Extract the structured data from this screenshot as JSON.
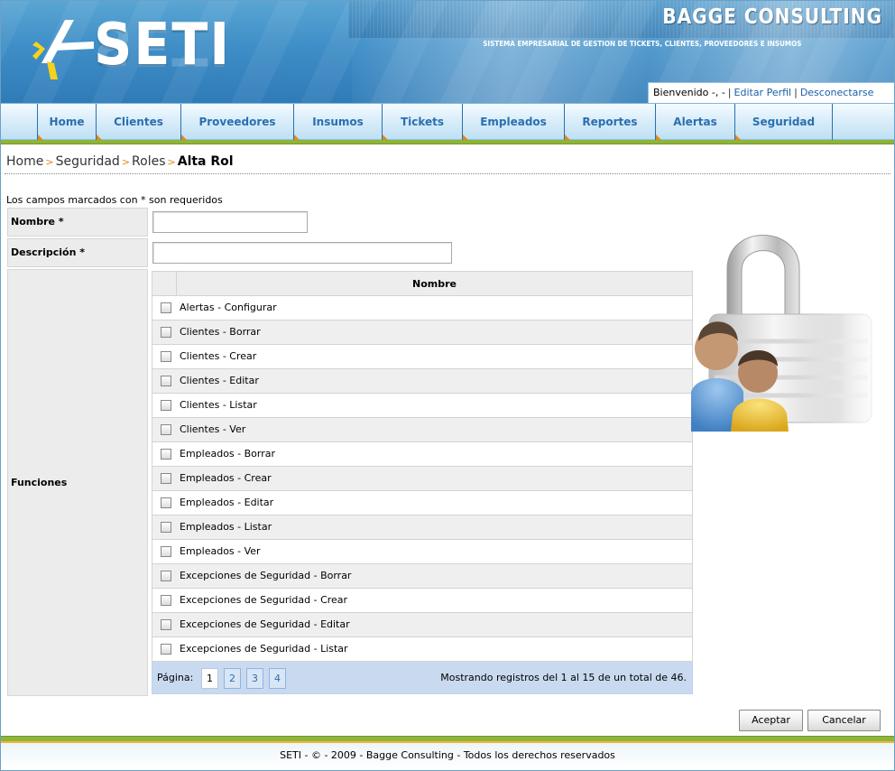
{
  "header": {
    "logo_text": "SETI",
    "brand": "BAGGE CONSULTING",
    "tagline": "SISTEMA EMPRESARIAL DE GESTION DE TICKETS, CLIENTES, PROVEEDORES E INSUMOS",
    "welcome": "Bienvenido -, -",
    "edit_profile": "Editar Perfil",
    "logout": "Desconectarse"
  },
  "nav": {
    "items": [
      {
        "label": "Home"
      },
      {
        "label": "Clientes"
      },
      {
        "label": "Proveedores"
      },
      {
        "label": "Insumos"
      },
      {
        "label": "Tickets"
      },
      {
        "label": "Empleados"
      },
      {
        "label": "Reportes"
      },
      {
        "label": "Alertas"
      },
      {
        "label": "Seguridad"
      }
    ]
  },
  "breadcrumb": {
    "items": [
      "Home",
      "Seguridad",
      "Roles"
    ],
    "current": "Alta Rol"
  },
  "form": {
    "required_note": "Los campos marcados con * son requeridos",
    "nombre_label": "Nombre *",
    "nombre_value": "",
    "descripcion_label": "Descripción *",
    "descripcion_value": "",
    "funciones_label": "Funciones"
  },
  "grid": {
    "column_header": "Nombre",
    "rows": [
      {
        "label": "Alertas - Configurar",
        "checked": false
      },
      {
        "label": "Clientes - Borrar",
        "checked": false
      },
      {
        "label": "Clientes - Crear",
        "checked": false
      },
      {
        "label": "Clientes - Editar",
        "checked": false
      },
      {
        "label": "Clientes - Listar",
        "checked": false
      },
      {
        "label": "Clientes - Ver",
        "checked": false
      },
      {
        "label": "Empleados - Borrar",
        "checked": false
      },
      {
        "label": "Empleados - Crear",
        "checked": false
      },
      {
        "label": "Empleados - Editar",
        "checked": false
      },
      {
        "label": "Empleados - Listar",
        "checked": false
      },
      {
        "label": "Empleados - Ver",
        "checked": false
      },
      {
        "label": "Excepciones de Seguridad - Borrar",
        "checked": false
      },
      {
        "label": "Excepciones de Seguridad - Crear",
        "checked": false
      },
      {
        "label": "Excepciones de Seguridad - Editar",
        "checked": false
      },
      {
        "label": "Excepciones de Seguridad - Listar",
        "checked": false
      }
    ],
    "pager": {
      "label": "Página:",
      "pages": [
        "1",
        "2",
        "3",
        "4"
      ],
      "current_page": "1",
      "info": "Mostrando registros del 1 al 15 de un total de 46."
    }
  },
  "actions": {
    "accept": "Aceptar",
    "cancel": "Cancelar"
  },
  "footer": {
    "text": "SETI - © - 2009 - Bagge Consulting - Todos los derechos reservados"
  },
  "colors": {
    "header_blue": "#3f8ec7",
    "nav_text": "#2a6fb0",
    "accent_green": "#8fb43a",
    "accent_orange": "#e08a1a",
    "link_blue": "#1a5fa8"
  },
  "icons": [
    "seti-logo-icon",
    "lock-users-icon",
    "checkbox-icon"
  ]
}
